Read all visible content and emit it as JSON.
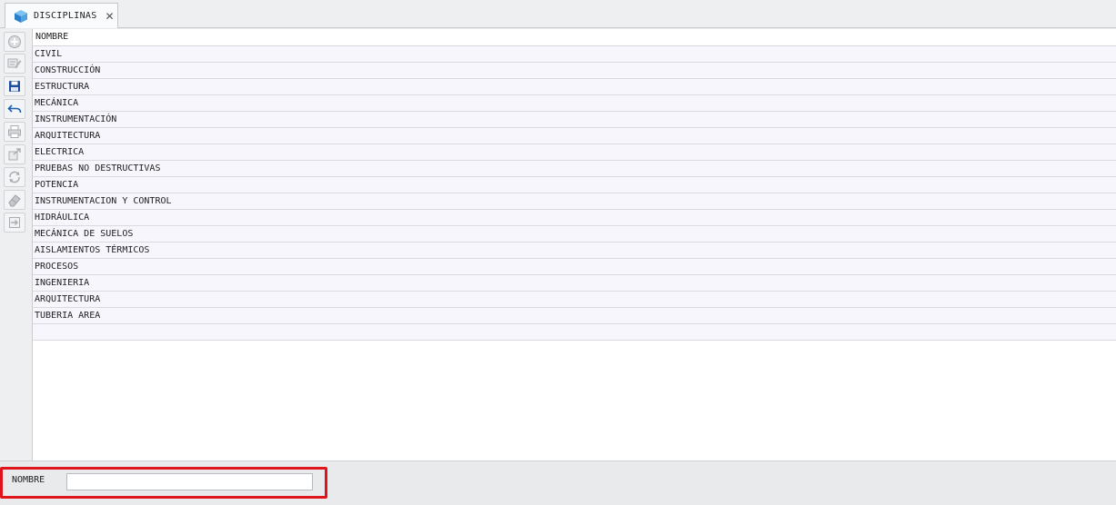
{
  "tab": {
    "label": "DISCIPLINAS",
    "close_glyph": "✕",
    "icon": "cube-icon"
  },
  "toolbar": {
    "buttons": [
      {
        "name": "add-button",
        "icon": "plus-circle-icon",
        "enabled": false
      },
      {
        "name": "edit-button",
        "icon": "pencil-icon",
        "enabled": false
      },
      {
        "name": "save-button",
        "icon": "floppy-disk-icon",
        "enabled": true
      },
      {
        "name": "undo-button",
        "icon": "undo-arrow-icon",
        "enabled": true
      },
      {
        "name": "print-button",
        "icon": "printer-icon",
        "enabled": false
      },
      {
        "name": "export-button",
        "icon": "export-icon",
        "enabled": false
      },
      {
        "name": "refresh-button",
        "icon": "refresh-icon",
        "enabled": false
      },
      {
        "name": "erase-button",
        "icon": "eraser-icon",
        "enabled": false
      },
      {
        "name": "exit-button",
        "icon": "exit-icon",
        "enabled": false
      }
    ]
  },
  "grid": {
    "header": "NOMBRE",
    "rows": [
      "CIVIL",
      "CONSTRUCCIÓN",
      "ESTRUCTURA",
      "MECÁNICA",
      "INSTRUMENTACIÓN",
      "ARQUITECTURA",
      "ELECTRICA",
      "PRUEBAS NO DESTRUCTIVAS",
      "POTENCIA",
      "INSTRUMENTACION Y CONTROL",
      "HIDRÁULICA",
      "MECÁNICA DE SUELOS",
      "AISLAMIENTOS TÉRMICOS",
      "PROCESOS",
      "INGENIERIA",
      "ARQUITECTURA",
      "TUBERIA AREA",
      ""
    ]
  },
  "form": {
    "label": "NOMBRE",
    "value": "",
    "placeholder": ""
  },
  "colors": {
    "highlight": "#e0151b",
    "row_bg": "#f7f6fd",
    "icon_active": "#1e4f9c"
  }
}
